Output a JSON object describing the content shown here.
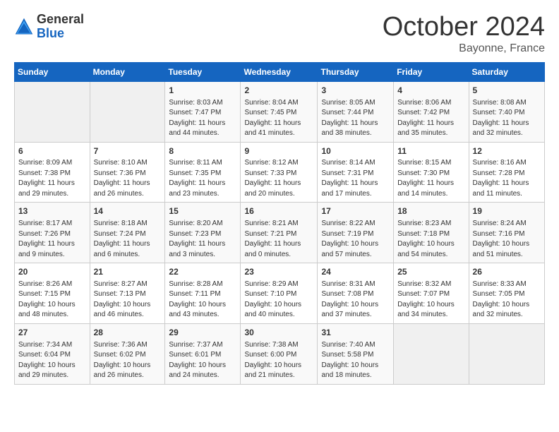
{
  "logo": {
    "line1": "General",
    "line2": "Blue"
  },
  "header": {
    "month": "October 2024",
    "location": "Bayonne, France"
  },
  "weekdays": [
    "Sunday",
    "Monday",
    "Tuesday",
    "Wednesday",
    "Thursday",
    "Friday",
    "Saturday"
  ],
  "weeks": [
    [
      {
        "day": "",
        "info": ""
      },
      {
        "day": "",
        "info": ""
      },
      {
        "day": "1",
        "info": "Sunrise: 8:03 AM\nSunset: 7:47 PM\nDaylight: 11 hours and 44 minutes."
      },
      {
        "day": "2",
        "info": "Sunrise: 8:04 AM\nSunset: 7:45 PM\nDaylight: 11 hours and 41 minutes."
      },
      {
        "day": "3",
        "info": "Sunrise: 8:05 AM\nSunset: 7:44 PM\nDaylight: 11 hours and 38 minutes."
      },
      {
        "day": "4",
        "info": "Sunrise: 8:06 AM\nSunset: 7:42 PM\nDaylight: 11 hours and 35 minutes."
      },
      {
        "day": "5",
        "info": "Sunrise: 8:08 AM\nSunset: 7:40 PM\nDaylight: 11 hours and 32 minutes."
      }
    ],
    [
      {
        "day": "6",
        "info": "Sunrise: 8:09 AM\nSunset: 7:38 PM\nDaylight: 11 hours and 29 minutes."
      },
      {
        "day": "7",
        "info": "Sunrise: 8:10 AM\nSunset: 7:36 PM\nDaylight: 11 hours and 26 minutes."
      },
      {
        "day": "8",
        "info": "Sunrise: 8:11 AM\nSunset: 7:35 PM\nDaylight: 11 hours and 23 minutes."
      },
      {
        "day": "9",
        "info": "Sunrise: 8:12 AM\nSunset: 7:33 PM\nDaylight: 11 hours and 20 minutes."
      },
      {
        "day": "10",
        "info": "Sunrise: 8:14 AM\nSunset: 7:31 PM\nDaylight: 11 hours and 17 minutes."
      },
      {
        "day": "11",
        "info": "Sunrise: 8:15 AM\nSunset: 7:30 PM\nDaylight: 11 hours and 14 minutes."
      },
      {
        "day": "12",
        "info": "Sunrise: 8:16 AM\nSunset: 7:28 PM\nDaylight: 11 hours and 11 minutes."
      }
    ],
    [
      {
        "day": "13",
        "info": "Sunrise: 8:17 AM\nSunset: 7:26 PM\nDaylight: 11 hours and 9 minutes."
      },
      {
        "day": "14",
        "info": "Sunrise: 8:18 AM\nSunset: 7:24 PM\nDaylight: 11 hours and 6 minutes."
      },
      {
        "day": "15",
        "info": "Sunrise: 8:20 AM\nSunset: 7:23 PM\nDaylight: 11 hours and 3 minutes."
      },
      {
        "day": "16",
        "info": "Sunrise: 8:21 AM\nSunset: 7:21 PM\nDaylight: 11 hours and 0 minutes."
      },
      {
        "day": "17",
        "info": "Sunrise: 8:22 AM\nSunset: 7:19 PM\nDaylight: 10 hours and 57 minutes."
      },
      {
        "day": "18",
        "info": "Sunrise: 8:23 AM\nSunset: 7:18 PM\nDaylight: 10 hours and 54 minutes."
      },
      {
        "day": "19",
        "info": "Sunrise: 8:24 AM\nSunset: 7:16 PM\nDaylight: 10 hours and 51 minutes."
      }
    ],
    [
      {
        "day": "20",
        "info": "Sunrise: 8:26 AM\nSunset: 7:15 PM\nDaylight: 10 hours and 48 minutes."
      },
      {
        "day": "21",
        "info": "Sunrise: 8:27 AM\nSunset: 7:13 PM\nDaylight: 10 hours and 46 minutes."
      },
      {
        "day": "22",
        "info": "Sunrise: 8:28 AM\nSunset: 7:11 PM\nDaylight: 10 hours and 43 minutes."
      },
      {
        "day": "23",
        "info": "Sunrise: 8:29 AM\nSunset: 7:10 PM\nDaylight: 10 hours and 40 minutes."
      },
      {
        "day": "24",
        "info": "Sunrise: 8:31 AM\nSunset: 7:08 PM\nDaylight: 10 hours and 37 minutes."
      },
      {
        "day": "25",
        "info": "Sunrise: 8:32 AM\nSunset: 7:07 PM\nDaylight: 10 hours and 34 minutes."
      },
      {
        "day": "26",
        "info": "Sunrise: 8:33 AM\nSunset: 7:05 PM\nDaylight: 10 hours and 32 minutes."
      }
    ],
    [
      {
        "day": "27",
        "info": "Sunrise: 7:34 AM\nSunset: 6:04 PM\nDaylight: 10 hours and 29 minutes."
      },
      {
        "day": "28",
        "info": "Sunrise: 7:36 AM\nSunset: 6:02 PM\nDaylight: 10 hours and 26 minutes."
      },
      {
        "day": "29",
        "info": "Sunrise: 7:37 AM\nSunset: 6:01 PM\nDaylight: 10 hours and 24 minutes."
      },
      {
        "day": "30",
        "info": "Sunrise: 7:38 AM\nSunset: 6:00 PM\nDaylight: 10 hours and 21 minutes."
      },
      {
        "day": "31",
        "info": "Sunrise: 7:40 AM\nSunset: 5:58 PM\nDaylight: 10 hours and 18 minutes."
      },
      {
        "day": "",
        "info": ""
      },
      {
        "day": "",
        "info": ""
      }
    ]
  ]
}
